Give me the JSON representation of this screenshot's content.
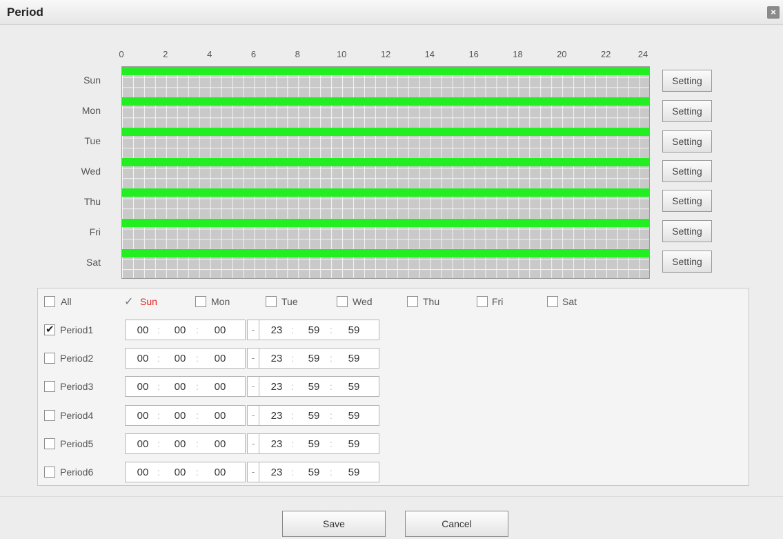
{
  "title": "Period",
  "close_icon": "×",
  "hours": [
    "0",
    "2",
    "4",
    "6",
    "8",
    "10",
    "12",
    "14",
    "16",
    "18",
    "20",
    "22",
    "24"
  ],
  "days": [
    "Sun",
    "Mon",
    "Tue",
    "Wed",
    "Thu",
    "Fri",
    "Sat"
  ],
  "schedule_color": "#22ee22",
  "setting_label": "Setting",
  "day_selector": {
    "all": {
      "label": "All",
      "checked": false
    },
    "days": [
      {
        "label": "Sun",
        "checked": true
      },
      {
        "label": "Mon",
        "checked": false
      },
      {
        "label": "Tue",
        "checked": false
      },
      {
        "label": "Wed",
        "checked": false
      },
      {
        "label": "Thu",
        "checked": false
      },
      {
        "label": "Fri",
        "checked": false
      },
      {
        "label": "Sat",
        "checked": false
      }
    ]
  },
  "periods": [
    {
      "label": "Period1",
      "checked": true,
      "start": [
        "00",
        "00",
        "00"
      ],
      "end": [
        "23",
        "59",
        "59"
      ]
    },
    {
      "label": "Period2",
      "checked": false,
      "start": [
        "00",
        "00",
        "00"
      ],
      "end": [
        "23",
        "59",
        "59"
      ]
    },
    {
      "label": "Period3",
      "checked": false,
      "start": [
        "00",
        "00",
        "00"
      ],
      "end": [
        "23",
        "59",
        "59"
      ]
    },
    {
      "label": "Period4",
      "checked": false,
      "start": [
        "00",
        "00",
        "00"
      ],
      "end": [
        "23",
        "59",
        "59"
      ]
    },
    {
      "label": "Period5",
      "checked": false,
      "start": [
        "00",
        "00",
        "00"
      ],
      "end": [
        "23",
        "59",
        "59"
      ]
    },
    {
      "label": "Period6",
      "checked": false,
      "start": [
        "00",
        "00",
        "00"
      ],
      "end": [
        "23",
        "59",
        "59"
      ]
    }
  ],
  "time_separator": ":",
  "range_separator": "-",
  "buttons": {
    "save": "Save",
    "cancel": "Cancel"
  }
}
